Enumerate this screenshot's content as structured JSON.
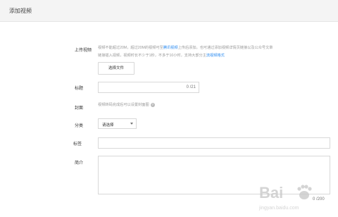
{
  "header": {
    "title": "添加视频"
  },
  "upload": {
    "label": "上传视频",
    "hint_line1_pre": "视频不能超过20M，超过20M的视频可至",
    "hint_line1_link": "腾讯视频",
    "hint_line1_post": "上传后添加，也可通过添加视频详情页链接以及公众号文章",
    "hint_line2_pre": "链接插入视频，视频时长不少于1秒，不多于10小时，支持大部分主",
    "hint_line2_link": "流视频格式",
    "button": "选择文件"
  },
  "title_field": {
    "label": "标题",
    "counter": "0 /21"
  },
  "cover": {
    "label": "封面",
    "hint": "视频转码完成后可以设置封面图",
    "help_icon": "?"
  },
  "category": {
    "label": "分类",
    "placeholder": "请选择"
  },
  "tags": {
    "label": "标签"
  },
  "intro": {
    "label": "简介",
    "counter": "0 /200"
  },
  "watermark": {
    "text": "Bai",
    "sub": "jingyan.baidu.com"
  }
}
